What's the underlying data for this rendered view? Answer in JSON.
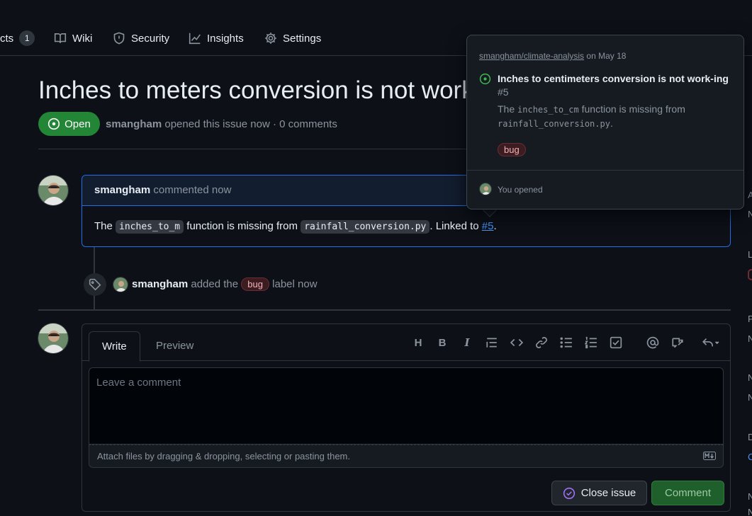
{
  "nav": {
    "items": [
      {
        "label": "cts",
        "icon": "table-icon",
        "count": "1"
      },
      {
        "label": "Wiki",
        "icon": "book-icon"
      },
      {
        "label": "Security",
        "icon": "shield-icon"
      },
      {
        "label": "Insights",
        "icon": "graph-icon"
      },
      {
        "label": "Settings",
        "icon": "gear-icon"
      }
    ]
  },
  "issue": {
    "title": "Inches to meters conversion is not work",
    "state": "Open",
    "author": "smangham",
    "meta_rest": "opened this issue now · 0 comments"
  },
  "comment": {
    "author": "smangham",
    "time": "commented now",
    "body_pre": "The",
    "code1": "inches_to_m",
    "body_mid": "function is missing from",
    "code2": "rainfall_conversion.py",
    "body_post": ". Linked to",
    "link": "#5",
    "body_end": "."
  },
  "event": {
    "actor": "smangham",
    "text_pre": "added the",
    "label": "bug",
    "text_post": "label now"
  },
  "composer": {
    "tab_write": "Write",
    "tab_preview": "Preview",
    "placeholder": "Leave a comment",
    "attach_text": "Attach files by dragging & dropping, selecting or pasting them.",
    "close_label": "Close issue",
    "comment_label": "Comment",
    "tools": [
      "H",
      "B",
      "I"
    ]
  },
  "hovercard": {
    "repo": "smangham/climate-analysis",
    "date": "on May 18",
    "title": "Inches to centimeters conversion is not work-ing",
    "number": "#5",
    "desc_pre": "The",
    "desc_code1": "inches_to_cm",
    "desc_mid": "function is missing from",
    "desc_code2": "rainfall_conversion.py",
    "desc_end": ".",
    "label": "bug",
    "footer": "You opened"
  },
  "colors": {
    "open_green": "#238636",
    "link_blue": "#4493f8",
    "bug_label": "#f4b3b8"
  }
}
